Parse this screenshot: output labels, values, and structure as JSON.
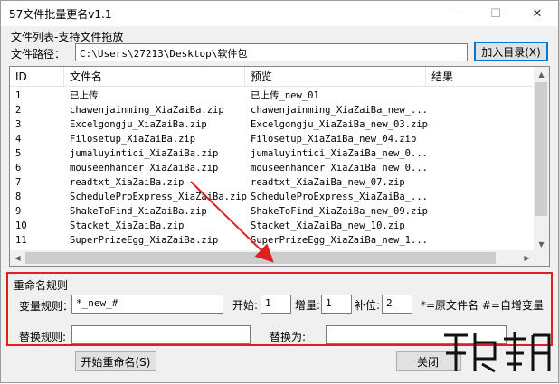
{
  "window": {
    "title": "57文件批量更名v1.1"
  },
  "titlebar_buttons": {
    "minimize": "—",
    "maximize": "☐",
    "close": "✕"
  },
  "file_group": {
    "title": "文件列表-支持文件拖放",
    "path_label": "文件路径：",
    "path_value": "C:\\Users\\27213\\Desktop\\软件包",
    "add_dir_label": "加入目录(X)"
  },
  "list": {
    "columns": [
      "ID",
      "文件名",
      "预览",
      "结果"
    ],
    "rows": [
      {
        "id": "1",
        "name": "已上传",
        "preview": "已上传_new_01",
        "result": ""
      },
      {
        "id": "2",
        "name": "chawenjainming_XiaZaiBa.zip",
        "preview": "chawenjainming_XiaZaiBa_new_...",
        "result": ""
      },
      {
        "id": "3",
        "name": "Excelgongju_XiaZaiBa.zip",
        "preview": "Excelgongju_XiaZaiBa_new_03.zip",
        "result": ""
      },
      {
        "id": "4",
        "name": "Filosetup_XiaZaiBa.zip",
        "preview": "Filosetup_XiaZaiBa_new_04.zip",
        "result": ""
      },
      {
        "id": "5",
        "name": "jumaluyintici_XiaZaiBa.zip",
        "preview": "jumaluyintici_XiaZaiBa_new_0...",
        "result": ""
      },
      {
        "id": "6",
        "name": "mouseenhancer_XiaZaiBa.zip",
        "preview": "mouseenhancer_XiaZaiBa_new_0...",
        "result": ""
      },
      {
        "id": "7",
        "name": "readtxt_XiaZaiBa.zip",
        "preview": "readtxt_XiaZaiBa_new_07.zip",
        "result": ""
      },
      {
        "id": "8",
        "name": "ScheduleProExpress_XiaZaiBa.zip",
        "preview": "ScheduleProExpress_XiaZaiBa_...",
        "result": ""
      },
      {
        "id": "9",
        "name": "ShakeToFind_XiaZaiBa.zip",
        "preview": "ShakeToFind_XiaZaiBa_new_09.zip",
        "result": ""
      },
      {
        "id": "10",
        "name": "Stacket_XiaZaiBa.zip",
        "preview": "Stacket_XiaZaiBa_new_10.zip",
        "result": ""
      },
      {
        "id": "11",
        "name": "SuperPrizeEgg_XiaZaiBa.zip",
        "preview": "SuperPrizeEgg_XiaZaiBa_new_1...",
        "result": ""
      }
    ]
  },
  "rename_rules": {
    "title": "重命名规则",
    "variable_label": "变量规则：",
    "variable_value": "*_new_#",
    "start_label": "开始:",
    "start_value": "1",
    "increment_label": "增量:",
    "increment_value": "1",
    "pad_label": "补位:",
    "pad_value": "2",
    "hint": "*=原文件名 #=自增变量",
    "replace_label": "替换规则:",
    "replace_value": "",
    "replace_to_label": "替换为:",
    "replace_to_value": ""
  },
  "footer": {
    "start_rename_label": "开始重命名(S)",
    "close_label": "关闭"
  },
  "colors": {
    "highlight_box": "#e02020",
    "arrow": "#e02020",
    "focus": "#0078d7"
  }
}
